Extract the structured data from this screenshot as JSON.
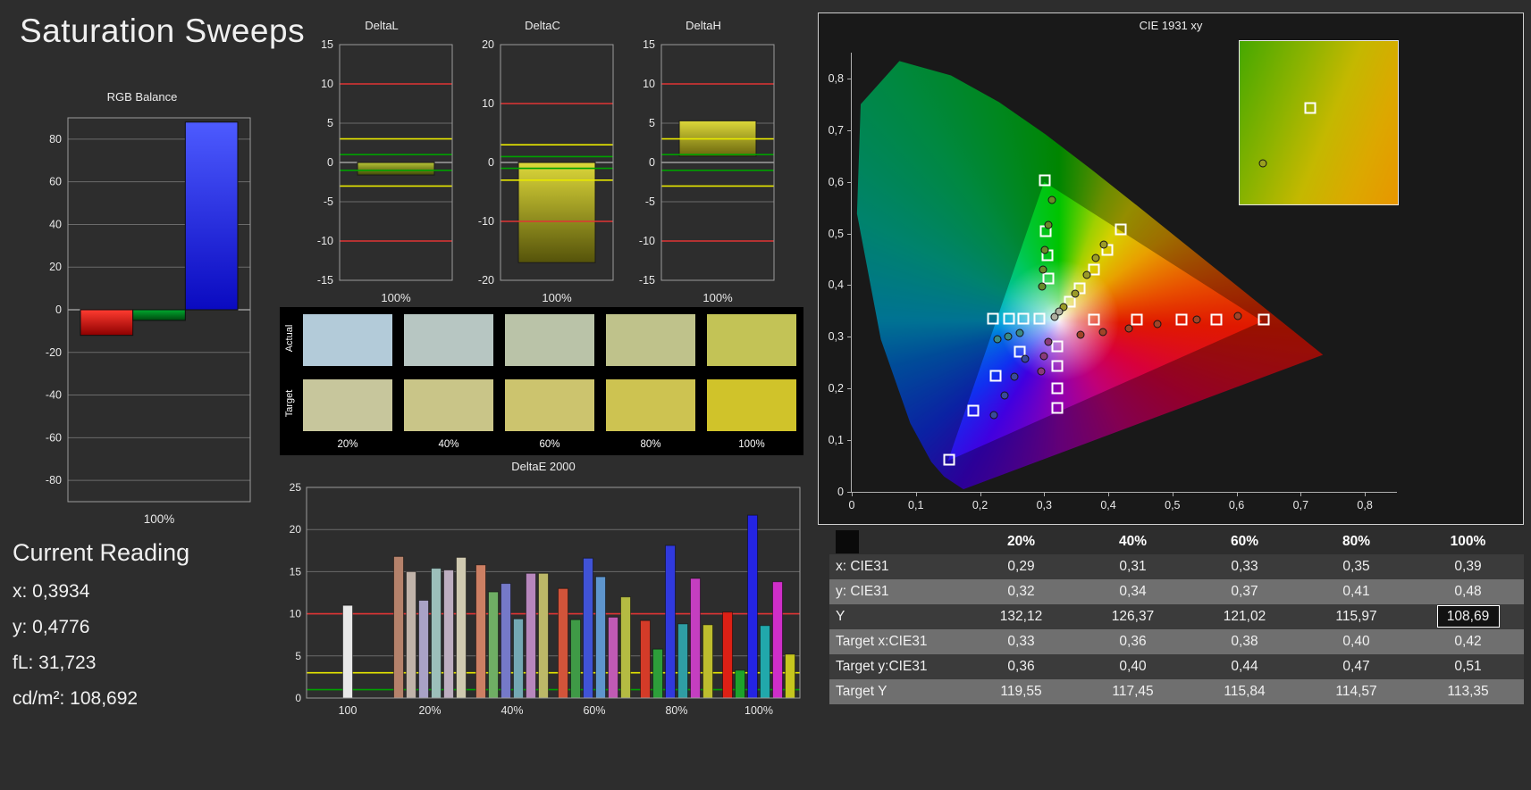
{
  "page": {
    "title": "Saturation Sweeps"
  },
  "current_reading": {
    "heading": "Current Reading",
    "lines": [
      "x: 0,3934",
      "y: 0,4776",
      "fL: 31,723",
      "cd/m²: 108,692"
    ]
  },
  "swatches": {
    "row_labels": [
      "Actual",
      "Target"
    ],
    "col_labels": [
      "20%",
      "40%",
      "60%",
      "80%",
      "100%"
    ],
    "actual_colors": [
      "#b3cbd9",
      "#b7c6c2",
      "#bac3a8",
      "#bfc28b",
      "#c3c356"
    ],
    "target_colors": [
      "#c7c69c",
      "#c9c588",
      "#ccc46e",
      "#cdc351",
      "#d0c32a"
    ]
  },
  "table": {
    "headers": [
      "20%",
      "40%",
      "60%",
      "80%",
      "100%"
    ],
    "rows": [
      {
        "label": "x: CIE31",
        "values": [
          "0,29",
          "0,31",
          "0,33",
          "0,35",
          "0,39"
        ]
      },
      {
        "label": "y: CIE31",
        "values": [
          "0,32",
          "0,34",
          "0,37",
          "0,41",
          "0,48"
        ]
      },
      {
        "label": "Y",
        "values": [
          "132,12",
          "126,37",
          "121,02",
          "115,97",
          "108,69"
        ],
        "highlight_last": true
      },
      {
        "label": "Target x:CIE31",
        "values": [
          "0,33",
          "0,36",
          "0,38",
          "0,40",
          "0,42"
        ]
      },
      {
        "label": "Target y:CIE31",
        "values": [
          "0,36",
          "0,40",
          "0,44",
          "0,47",
          "0,51"
        ]
      },
      {
        "label": "Target Y",
        "values": [
          "119,55",
          "117,45",
          "115,84",
          "114,57",
          "113,35"
        ]
      }
    ]
  },
  "chart_data": [
    {
      "id": "rgb_balance",
      "type": "bar",
      "title": "RGB Balance",
      "xlabel": "100%",
      "ylim": [
        -90,
        90
      ],
      "yticks": [
        80,
        60,
        40,
        20,
        0,
        -20,
        -40,
        -60,
        -80
      ],
      "series": [
        {
          "name": "Red",
          "value": -12,
          "color": "#dd1111"
        },
        {
          "name": "Green",
          "value": -5,
          "color": "#00881c"
        },
        {
          "name": "Blue",
          "value": 88,
          "color": "#2222ee"
        }
      ]
    },
    {
      "id": "delta_l",
      "type": "bar",
      "title": "DeltaL",
      "xlabel": "100%",
      "ylim": [
        -15,
        15
      ],
      "yticks": [
        15,
        10,
        5,
        0,
        -5,
        -10,
        -15
      ],
      "bar": {
        "from": -1.6,
        "to": 0
      },
      "bar_colors": [
        "#b8c536",
        "#3f4a07"
      ],
      "ref_lines": [
        {
          "v": 10,
          "color": "#e03434"
        },
        {
          "v": 3,
          "color": "#e8e800"
        },
        {
          "v": 1,
          "color": "#00a000"
        },
        {
          "v": -1,
          "color": "#00a000"
        },
        {
          "v": -3,
          "color": "#e8e800"
        },
        {
          "v": -10,
          "color": "#e03434"
        }
      ]
    },
    {
      "id": "delta_c",
      "type": "bar",
      "title": "DeltaC",
      "xlabel": "100%",
      "ylim": [
        -20,
        20
      ],
      "yticks": [
        20,
        10,
        0,
        -10,
        -20
      ],
      "bar": {
        "from": -17,
        "to": 0
      },
      "bar_colors": [
        "#ddd83a",
        "#55530a"
      ],
      "ref_lines": [
        {
          "v": 10,
          "color": "#e03434"
        },
        {
          "v": 3,
          "color": "#e8e800"
        },
        {
          "v": 1,
          "color": "#00a000"
        },
        {
          "v": -1,
          "color": "#00a000"
        },
        {
          "v": -3,
          "color": "#e8e800"
        },
        {
          "v": -10,
          "color": "#e03434"
        }
      ]
    },
    {
      "id": "delta_h",
      "type": "bar",
      "title": "DeltaH",
      "xlabel": "100%",
      "ylim": [
        -15,
        15
      ],
      "yticks": [
        15,
        10,
        5,
        0,
        -5,
        -10,
        -15
      ],
      "bar": {
        "from": 0.8,
        "to": 5.3
      },
      "bar_colors": [
        "#ddd83a",
        "#6a660e"
      ],
      "ref_lines": [
        {
          "v": 10,
          "color": "#e03434"
        },
        {
          "v": 3,
          "color": "#e8e800"
        },
        {
          "v": 1,
          "color": "#00a000"
        },
        {
          "v": -1,
          "color": "#00a000"
        },
        {
          "v": -3,
          "color": "#e8e800"
        },
        {
          "v": -10,
          "color": "#e03434"
        }
      ]
    },
    {
      "id": "delta_e_2000",
      "type": "bar",
      "title": "DeltaE 2000",
      "ylim": [
        0,
        25
      ],
      "yticks": [
        0,
        5,
        10,
        15,
        20,
        25
      ],
      "ref_lines": [
        {
          "v": 10,
          "color": "#e03434"
        },
        {
          "v": 3,
          "color": "#e8e800"
        },
        {
          "v": 1,
          "color": "#00a000"
        }
      ],
      "groups": [
        {
          "label": "100",
          "bars": [
            {
              "v": 11.0,
              "color": "#e8e8e8"
            }
          ]
        },
        {
          "label": "20%",
          "bars": [
            {
              "v": 16.8,
              "color": "#b5826b"
            },
            {
              "v": 15.0,
              "color": "#c0b3a9"
            },
            {
              "v": 11.6,
              "color": "#a9a2c6"
            },
            {
              "v": 15.4,
              "color": "#9cbfba"
            },
            {
              "v": 15.2,
              "color": "#bdaec0"
            },
            {
              "v": 16.7,
              "color": "#cfc9b0"
            }
          ]
        },
        {
          "label": "40%",
          "bars": [
            {
              "v": 15.8,
              "color": "#cd7f63"
            },
            {
              "v": 12.6,
              "color": "#6fae64"
            },
            {
              "v": 13.6,
              "color": "#7579c8"
            },
            {
              "v": 9.4,
              "color": "#74a8b4"
            },
            {
              "v": 14.8,
              "color": "#b787bc"
            },
            {
              "v": 14.8,
              "color": "#bcb868"
            }
          ]
        },
        {
          "label": "60%",
          "bars": [
            {
              "v": 13.0,
              "color": "#d2543a"
            },
            {
              "v": 9.3,
              "color": "#3f9a46"
            },
            {
              "v": 16.6,
              "color": "#4053d6"
            },
            {
              "v": 14.4,
              "color": "#5e95cd"
            },
            {
              "v": 9.6,
              "color": "#c05ab4"
            },
            {
              "v": 12.0,
              "color": "#b4bb42"
            }
          ]
        },
        {
          "label": "80%",
          "bars": [
            {
              "v": 9.2,
              "color": "#d43b28"
            },
            {
              "v": 5.8,
              "color": "#2d9e3a"
            },
            {
              "v": 18.1,
              "color": "#3039dd"
            },
            {
              "v": 8.8,
              "color": "#2f9ea4"
            },
            {
              "v": 14.2,
              "color": "#c43ec0"
            },
            {
              "v": 8.7,
              "color": "#bdbd2e"
            }
          ]
        },
        {
          "label": "100%",
          "bars": [
            {
              "v": 10.2,
              "color": "#dd2015"
            },
            {
              "v": 3.3,
              "color": "#1da32b"
            },
            {
              "v": 21.7,
              "color": "#2424e4"
            },
            {
              "v": 8.6,
              "color": "#21a8ab"
            },
            {
              "v": 13.8,
              "color": "#cf2ec9"
            },
            {
              "v": 5.2,
              "color": "#c6c61e"
            }
          ]
        }
      ]
    },
    {
      "id": "cie_1931_xy",
      "type": "scatter",
      "title": "CIE 1931 xy",
      "xlim": [
        0,
        0.85
      ],
      "ylim": [
        0,
        0.85
      ],
      "xticks": [
        "0",
        "0,1",
        "0,2",
        "0,3",
        "0,4",
        "0,5",
        "0,6",
        "0,7",
        "0,8"
      ],
      "yticks": [
        "0",
        "0,1",
        "0,2",
        "0,3",
        "0,4",
        "0,5",
        "0,6",
        "0,7",
        "0,8"
      ],
      "targets": [
        [
          0.22,
          0.335
        ],
        [
          0.245,
          0.335
        ],
        [
          0.268,
          0.335
        ],
        [
          0.293,
          0.335
        ],
        [
          0.377,
          0.334
        ],
        [
          0.445,
          0.334
        ],
        [
          0.514,
          0.334
        ],
        [
          0.569,
          0.334
        ],
        [
          0.642,
          0.333
        ],
        [
          0.301,
          0.603
        ],
        [
          0.303,
          0.505
        ],
        [
          0.305,
          0.458
        ],
        [
          0.307,
          0.413
        ],
        [
          0.34,
          0.368
        ],
        [
          0.355,
          0.393
        ],
        [
          0.377,
          0.431
        ],
        [
          0.399,
          0.468
        ],
        [
          0.42,
          0.508
        ],
        [
          0.321,
          0.281
        ],
        [
          0.321,
          0.243
        ],
        [
          0.321,
          0.201
        ],
        [
          0.321,
          0.162
        ],
        [
          0.262,
          0.272
        ],
        [
          0.225,
          0.224
        ],
        [
          0.189,
          0.158
        ],
        [
          0.152,
          0.063
        ]
      ],
      "measurements": [
        {
          "x": 0.312,
          "y": 0.565,
          "c": "#6a8a2a"
        },
        {
          "x": 0.306,
          "y": 0.516,
          "c": "#6a8a2a"
        },
        {
          "x": 0.301,
          "y": 0.469,
          "c": "#6a8a2a"
        },
        {
          "x": 0.298,
          "y": 0.431,
          "c": "#6a8a2a"
        },
        {
          "x": 0.297,
          "y": 0.397,
          "c": "#6a8a2a"
        },
        {
          "x": 0.33,
          "y": 0.358,
          "c": "#9a9a28"
        },
        {
          "x": 0.349,
          "y": 0.384,
          "c": "#9a9a28"
        },
        {
          "x": 0.366,
          "y": 0.42,
          "c": "#9a9a28"
        },
        {
          "x": 0.381,
          "y": 0.452,
          "c": "#9a9a28"
        },
        {
          "x": 0.393,
          "y": 0.478,
          "c": "#9a9a28"
        },
        {
          "x": 0.357,
          "y": 0.304,
          "c": "#a04428"
        },
        {
          "x": 0.392,
          "y": 0.309,
          "c": "#a04428"
        },
        {
          "x": 0.432,
          "y": 0.317,
          "c": "#a04428"
        },
        {
          "x": 0.476,
          "y": 0.324,
          "c": "#a04428"
        },
        {
          "x": 0.538,
          "y": 0.333,
          "c": "#a04428"
        },
        {
          "x": 0.602,
          "y": 0.34,
          "c": "#a04428"
        },
        {
          "x": 0.262,
          "y": 0.308,
          "c": "#3a8a86"
        },
        {
          "x": 0.244,
          "y": 0.301,
          "c": "#3a8a86"
        },
        {
          "x": 0.227,
          "y": 0.296,
          "c": "#3a8a86"
        },
        {
          "x": 0.27,
          "y": 0.258,
          "c": "#3a4a9a"
        },
        {
          "x": 0.254,
          "y": 0.222,
          "c": "#3a4a9a"
        },
        {
          "x": 0.238,
          "y": 0.186,
          "c": "#3a4a9a"
        },
        {
          "x": 0.221,
          "y": 0.149,
          "c": "#3a4a9a"
        },
        {
          "x": 0.306,
          "y": 0.29,
          "c": "#8a3a7a"
        },
        {
          "x": 0.3,
          "y": 0.263,
          "c": "#8a3a7a"
        },
        {
          "x": 0.295,
          "y": 0.234,
          "c": "#8a3a7a"
        },
        {
          "x": 0.317,
          "y": 0.338,
          "c": "#b0b0a0"
        },
        {
          "x": 0.323,
          "y": 0.349,
          "c": "#b0b0a0"
        }
      ],
      "inset": {
        "region_x": [
          0.38,
          0.47
        ],
        "region_y": [
          0.455,
          0.545
        ],
        "target": [
          0.42,
          0.508
        ],
        "measurement": [
          0.3934,
          0.4776
        ]
      }
    }
  ]
}
